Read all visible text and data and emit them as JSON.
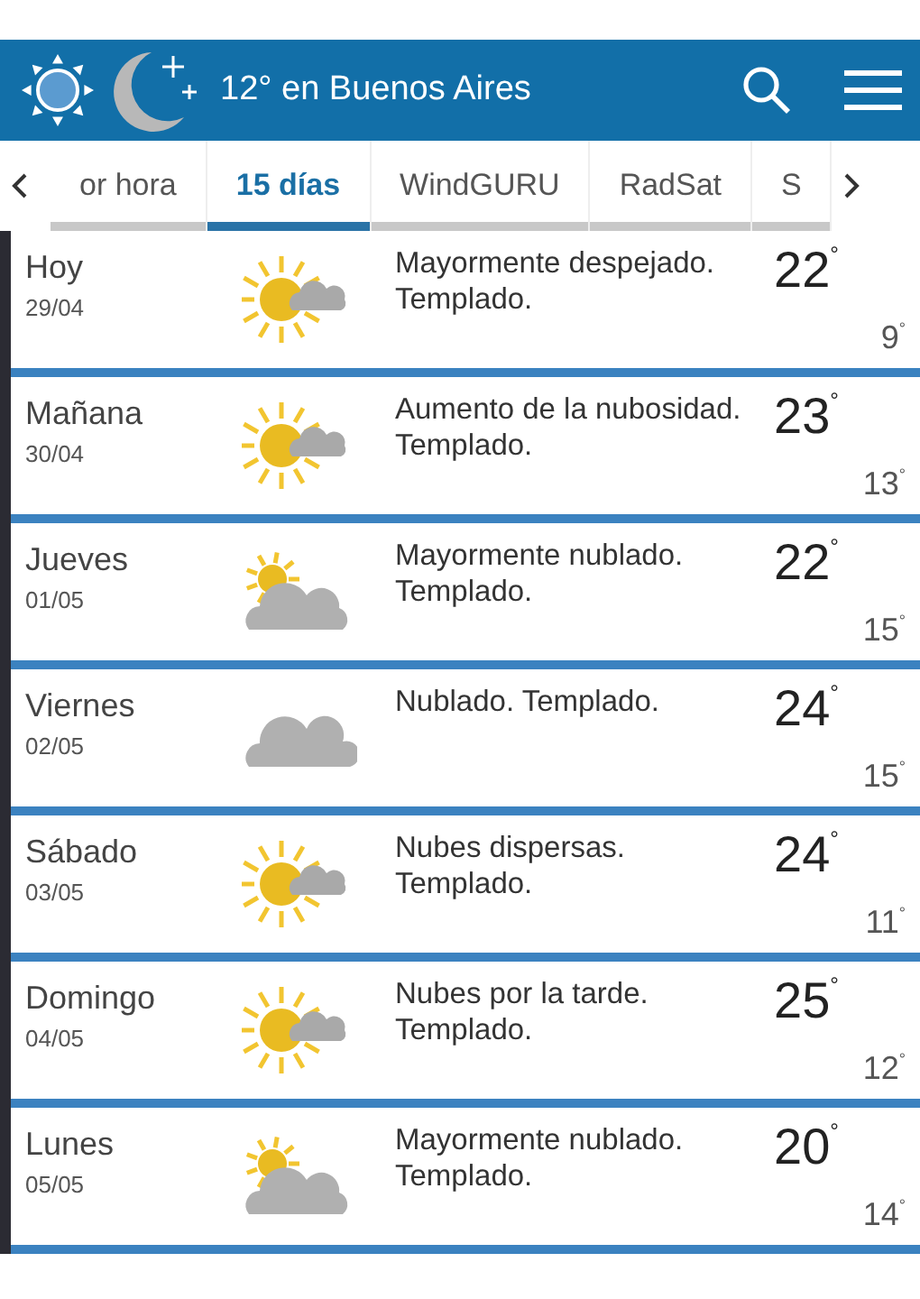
{
  "header": {
    "title": "12° en Buenos Aires"
  },
  "tabs": [
    {
      "label": "or hora",
      "selected": false
    },
    {
      "label": "15 días",
      "selected": true
    },
    {
      "label": "WindGURU",
      "selected": false
    },
    {
      "label": "RadSat",
      "selected": false
    },
    {
      "label": "S",
      "selected": false
    }
  ],
  "days": [
    {
      "day": "Hoy",
      "date": "29/04",
      "kind": "partly",
      "description": "Mayormente despejado. Templado.",
      "max": "22$^{°}$",
      "min": "9$^{°}$"
    },
    {
      "day": "Mañana",
      "date": "30/04",
      "kind": "partly",
      "description": "Aumento de la nubosidad. Templado.",
      "max": "23$^{°}$",
      "min": "13$^{°}$"
    },
    {
      "day": "Jueves",
      "date": "01/05",
      "kind": "mostly",
      "description": "Mayormente nublado. Templado.",
      "max": "22$^{°}$",
      "min": "15$^{°}$"
    },
    {
      "day": "Viernes",
      "date": "02/05",
      "kind": "cloudy",
      "description": "Nublado. Templado.",
      "max": "24$^{°}$",
      "min": "15$^{°}$"
    },
    {
      "day": "Sábado",
      "date": "03/05",
      "kind": "partly",
      "description": "Nubes dispersas. Templado.",
      "max": "24$^{°}$",
      "min": "11$^{°}$"
    },
    {
      "day": "Domingo",
      "date": "04/05",
      "kind": "partly",
      "description": "Nubes por la tarde. Templado.",
      "max": "25$^{°}$",
      "min": "12$^{°}$"
    },
    {
      "day": "Lunes",
      "date": "05/05",
      "kind": "mostly",
      "description": "Mayormente nublado. Templado.",
      "max": "20$^{°}$",
      "min": "14$^{°}$"
    }
  ]
}
